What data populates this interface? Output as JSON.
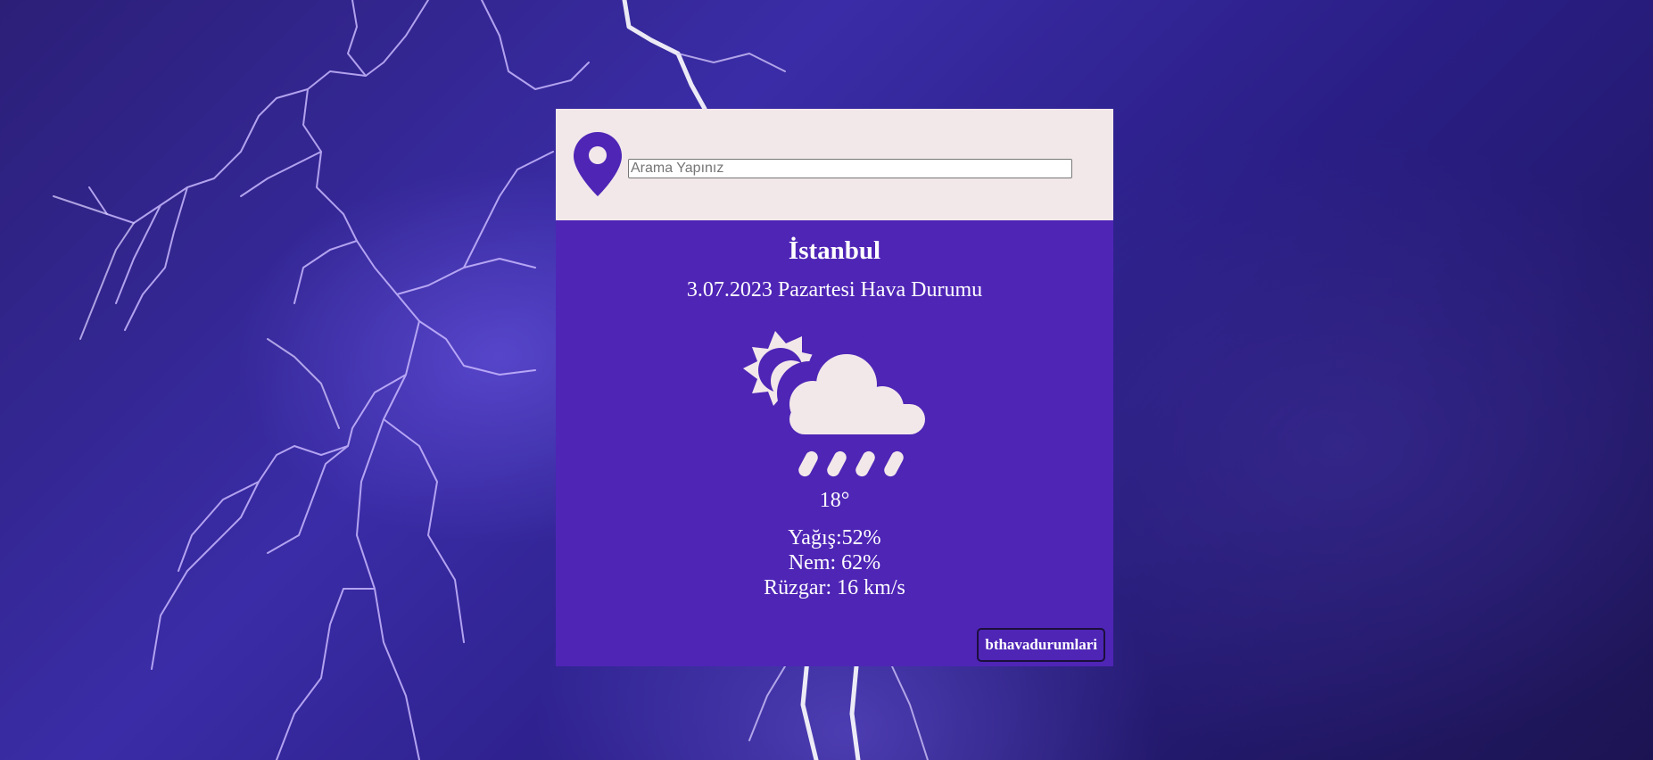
{
  "colors": {
    "panel_bg": "#4f25b6",
    "search_bg": "#f2e8ea",
    "icon_light": "#f2e8ea",
    "pin": "#4f25b6",
    "background": "#2b1f78"
  },
  "background_image": "lightning-storm-purple",
  "search": {
    "icon": "location-pin-icon",
    "placeholder": "Arama Yapınız",
    "value": ""
  },
  "weather": {
    "city": "İstanbul",
    "date_line": "3.07.2023 Pazartesi Hava Durumu",
    "icon": "sun-cloud-rain-icon",
    "temperature": "18°",
    "precipitation": "Yağış:52%",
    "humidity": "Nem: 62%",
    "wind": "Rüzgar: 16 km/s"
  },
  "footer": {
    "brand_button": "bthavadurumlari"
  }
}
